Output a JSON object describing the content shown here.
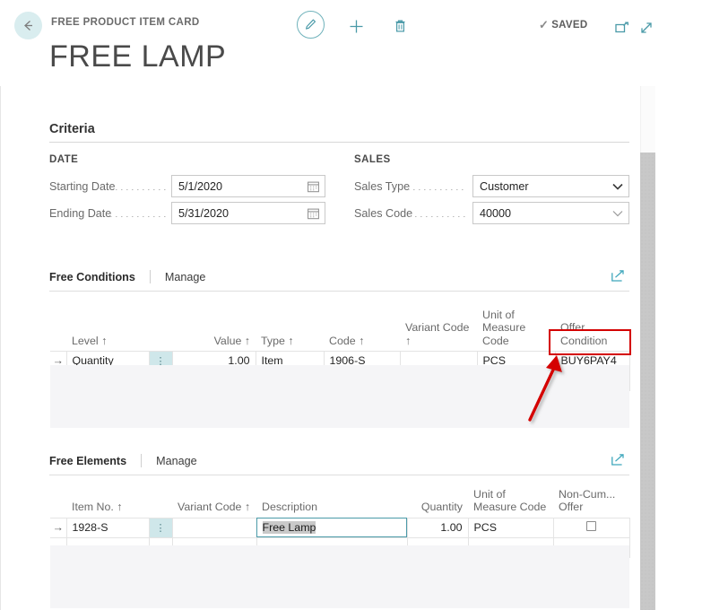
{
  "topbar": {
    "back_label": "Back",
    "breadcrumb": "FREE PRODUCT ITEM CARD",
    "page_title": "FREE LAMP",
    "edit_label": "Edit",
    "add_label": "New",
    "delete_label": "Delete",
    "saved_label": "SAVED",
    "saved_check": "✓",
    "popout_label": "Open in new window",
    "expand_label": "Expand"
  },
  "criteria": {
    "heading": "Criteria",
    "groups": {
      "date_label": "DATE",
      "sales_label": "SALES"
    },
    "fields": {
      "starting_date": {
        "label": "Starting Date",
        "value": "5/1/2020"
      },
      "ending_date": {
        "label": "Ending Date",
        "value": "5/31/2020"
      },
      "sales_type": {
        "label": "Sales Type",
        "value": "Customer"
      },
      "sales_code": {
        "label": "Sales Code",
        "value": "40000"
      }
    }
  },
  "free_conditions": {
    "tab_label": "Free Conditions",
    "manage_label": "Manage",
    "columns": [
      "Level ↑",
      "",
      "Value ↑",
      "Type ↑",
      "Code ↑",
      "Variant Code ↑",
      "Unit of Measure Code",
      "Offer Condition"
    ],
    "rows": [
      {
        "indicator": "→",
        "level": "Quantity",
        "dots": "⋮",
        "value": "1.00",
        "type": "Item",
        "code": "1906-S",
        "variant_code": "",
        "uom_code": "PCS",
        "offer_condition": "BUY6PAY4"
      },
      {
        "indicator": "",
        "level": "",
        "dots": "",
        "value": "",
        "type": "",
        "code": "",
        "variant_code": "",
        "uom_code": "",
        "offer_condition": ""
      }
    ]
  },
  "free_elements": {
    "tab_label": "Free Elements",
    "manage_label": "Manage",
    "columns": [
      "Item No. ↑",
      "",
      "Variant Code ↑",
      "Description",
      "Quantity",
      "Unit of Measure Code",
      "Non-Cum... Offer"
    ],
    "rows": [
      {
        "indicator": "→",
        "item_no": "1928-S",
        "dots": "⋮",
        "variant_code": "",
        "description": "Free Lamp",
        "quantity": "1.00",
        "uom_code": "PCS",
        "non_cum_offer": false
      },
      {
        "indicator": "",
        "item_no": "",
        "dots": "",
        "variant_code": "",
        "description": "",
        "quantity": "",
        "uom_code": "",
        "non_cum_offer": null
      }
    ]
  },
  "annotation": {
    "highlight_target": "BUY6PAY4",
    "color": "#d40000"
  },
  "colors": {
    "accent": "#4a9aa8",
    "back_bubble": "#d9edef",
    "dots_cell": "#cfe7ea",
    "annotation": "#d40000"
  }
}
